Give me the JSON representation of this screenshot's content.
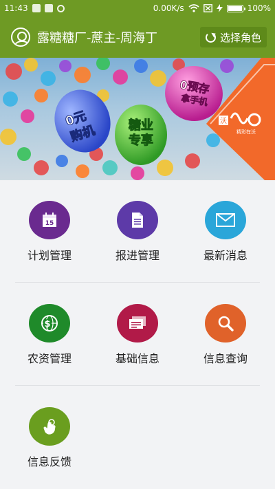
{
  "status_bar": {
    "time": "11:43",
    "net_speed": "0.00K/s",
    "battery": "100%"
  },
  "header": {
    "title": "露糖糖厂-蔗主-周海丁",
    "role_button": "选择角色",
    "color": "#6e9a24"
  },
  "banner": {
    "balloon_1": [
      "0元",
      "购机"
    ],
    "balloon_2": [
      "糖业",
      "专享"
    ],
    "balloon_3": [
      "0预存",
      "拿手机"
    ],
    "brand_text": "沃",
    "brand_slogan": "精彩在沃"
  },
  "menu": [
    {
      "label": "计划管理",
      "icon": "calendar-icon",
      "color": "#6a2a8f",
      "badge": "15"
    },
    {
      "label": "报进管理",
      "icon": "document-icon",
      "color": "#5d3aa8"
    },
    {
      "label": "最新消息",
      "icon": "envelope-icon",
      "color": "#2aa6d9"
    },
    {
      "label": "农资管理",
      "icon": "dollar-globe-icon",
      "color": "#1f8a2a"
    },
    {
      "label": "基础信息",
      "icon": "cards-icon",
      "color": "#b11a48"
    },
    {
      "label": "信息查询",
      "icon": "magnifier-icon",
      "color": "#e0622a"
    },
    {
      "label": "信息反馈",
      "icon": "hand-pointer-icon",
      "color": "#6a9e1f"
    }
  ]
}
